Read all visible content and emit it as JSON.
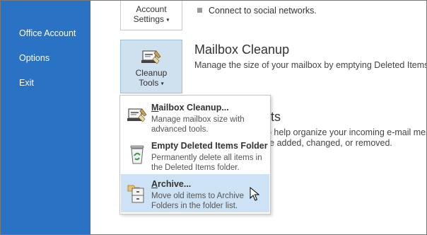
{
  "nav": {
    "items": [
      {
        "label": "Office Account"
      },
      {
        "label": "Options"
      },
      {
        "label": "Exit"
      }
    ]
  },
  "account_settings": {
    "line1": "Account",
    "line2": "Settings",
    "caret": "▾",
    "bullet": "Connect to social networks."
  },
  "cleanup_tools": {
    "line1": "Cleanup",
    "line2": "Tools",
    "caret": "▾"
  },
  "mailbox_cleanup_section": {
    "title": "Mailbox Cleanup",
    "description": "Manage the size of your mailbox by emptying Deleted Items and ar"
  },
  "rules_section": {
    "title_fragment": "rts",
    "line1": "o help organize your incoming e-mail messag",
    "line2": "re added, changed, or removed."
  },
  "menu": {
    "items": [
      {
        "title": "Mailbox Cleanup...",
        "accesskey": "M",
        "description": "Manage mailbox size with advanced tools.",
        "icon": "mailbox-cleanup-icon"
      },
      {
        "title": "Empty Deleted Items Folder",
        "accesskey": "",
        "description": "Permanently delete all items in the Deleted Items folder.",
        "icon": "recycle-bin-icon"
      },
      {
        "title": "Archive...",
        "accesskey": "A",
        "description": "Move old items to Archive Folders in the folder list.",
        "icon": "archive-icon",
        "highlighted": true
      }
    ]
  },
  "colors": {
    "nav_bg": "#2a72c4",
    "button_selected_bg": "#cfe0ef",
    "menu_hover_bg": "#cde2f4"
  }
}
